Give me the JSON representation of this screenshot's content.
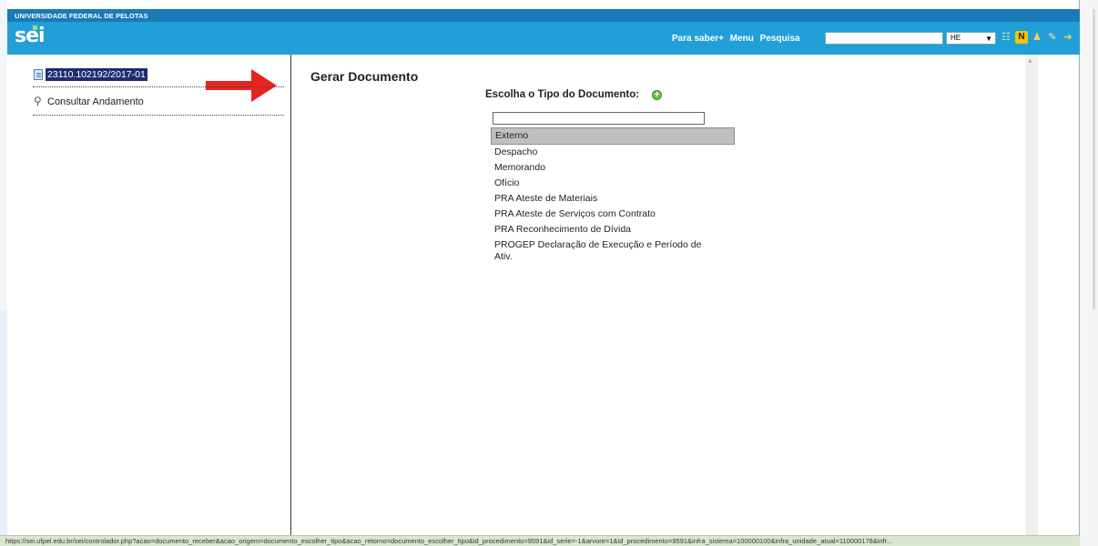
{
  "header": {
    "institution": "UNIVERSIDADE FEDERAL DE PELOTAS",
    "logo_text": "sei",
    "nav_links": [
      "Para saber+",
      "Menu",
      "Pesquisa"
    ],
    "search_value": "",
    "unit_selected": "HE",
    "icons": [
      "list-icon",
      "news-icon",
      "user-icon",
      "tools-icon",
      "exit-icon"
    ]
  },
  "left_panel": {
    "process_number": "23110.102192/2017-01",
    "consult_label": "Consultar Andamento"
  },
  "main": {
    "title": "Gerar Documento",
    "choose_label": "Escolha o Tipo do Documento:",
    "filter_value": "",
    "doc_types": [
      "Externo",
      "Despacho",
      "Memorando",
      "Ofício",
      "PRA Ateste de Materiais",
      "PRA Ateste de Serviços com Contrato",
      "PRA Reconhecimento de Dívida",
      "PROGEP Declaração de Execução e Período de Ativ."
    ],
    "selected_doc_type": "Externo"
  },
  "status_bar": {
    "url": "https://sei.ufpel.edu.br/sei/controlador.php?acao=documento_receber&acao_origem=documento_escolher_tipo&acao_retorno=documento_escolher_tipo&id_procedimento=9591&id_serie=-1&arvore=1&id_procedimento=9591&infra_sistema=100000100&infra_unidade_atual=110000178&infr..."
  },
  "colors": {
    "header_dark": "#1a7ab8",
    "header_bar": "#219fd9",
    "selection_highlight": "#1f2c72",
    "arrow": "#e8231f"
  }
}
